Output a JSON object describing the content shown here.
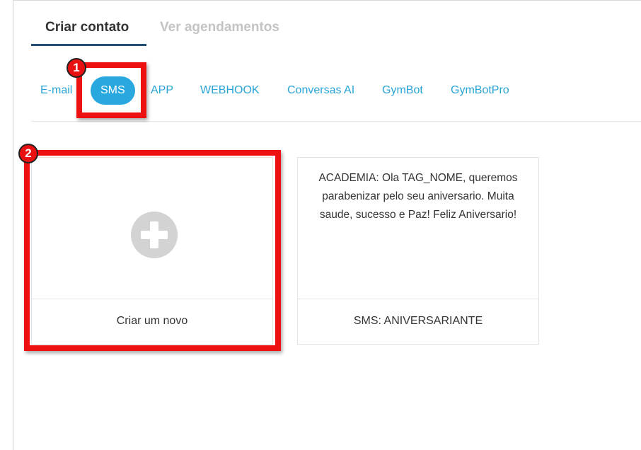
{
  "main_tabs": [
    {
      "label": "Criar contato",
      "active": true
    },
    {
      "label": "Ver agendamentos",
      "active": false
    }
  ],
  "sub_tabs": [
    {
      "label": "E-mail",
      "active": false
    },
    {
      "label": "SMS",
      "active": true
    },
    {
      "label": "APP",
      "active": false
    },
    {
      "label": "WEBHOOK",
      "active": false
    },
    {
      "label": "Conversas AI",
      "active": false
    },
    {
      "label": "GymBot",
      "active": false
    },
    {
      "label": "GymBotPro",
      "active": false
    }
  ],
  "cards": {
    "new": {
      "icon": "plus-circle-icon",
      "label": "Criar um novo"
    },
    "sms": {
      "message": "ACADEMIA: Ola TAG_NOME, queremos parabenizar pelo seu aniversario. Muita saude, sucesso e Paz! Feliz Aniversario!",
      "label": "SMS: ANIVERSARIANTE"
    }
  },
  "annotations": [
    {
      "number": "1"
    },
    {
      "number": "2"
    }
  ],
  "colors": {
    "accent": "#29a8e0",
    "tab_underline": "#1f4f78",
    "annotation_red": "#ee1111"
  }
}
